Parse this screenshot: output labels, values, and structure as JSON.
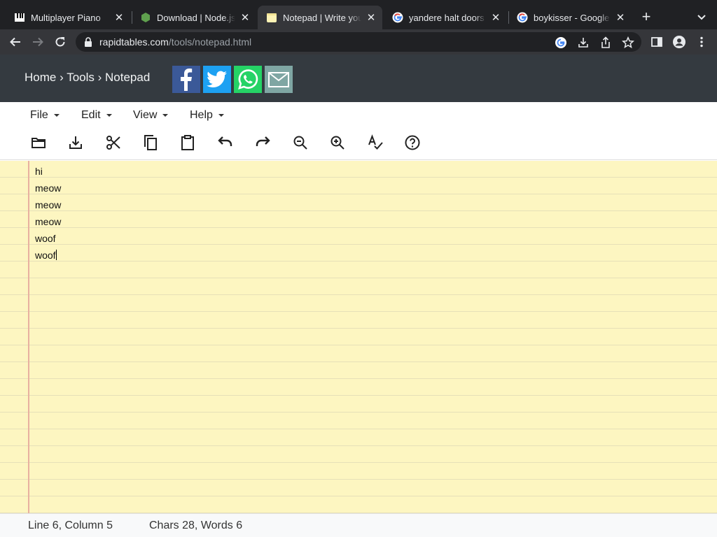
{
  "browser": {
    "tabs": [
      {
        "title": "Multiplayer Piano",
        "favicon": "piano-icon",
        "active": false
      },
      {
        "title": "Download | Node.js",
        "favicon": "nodejs-hexagon-icon",
        "active": false
      },
      {
        "title": "Notepad | Write your text online",
        "favicon": "notepad-icon",
        "active": true
      },
      {
        "title": "yandere halt doors - Google Search",
        "favicon": "google-g-icon",
        "active": false
      },
      {
        "title": "boykisser - Google Search",
        "favicon": "google-g-icon",
        "active": false
      }
    ],
    "new_tab_icon": "plus-icon",
    "url_host": "rapidtables.com",
    "url_path": "/tools/notepad.html"
  },
  "site": {
    "breadcrumb": [
      {
        "label": "Home"
      },
      {
        "label": "Tools"
      },
      {
        "label": "Notepad"
      }
    ],
    "separator": "›",
    "share_buttons": [
      {
        "name": "facebook-share-icon",
        "color": "#3b5998"
      },
      {
        "name": "twitter-share-icon",
        "color": "#1da1f2"
      },
      {
        "name": "whatsapp-share-icon",
        "color": "#25d366"
      },
      {
        "name": "email-share-icon",
        "color": "#7fa6a3"
      }
    ]
  },
  "menu": {
    "items": [
      {
        "label": "File"
      },
      {
        "label": "Edit"
      },
      {
        "label": "View"
      },
      {
        "label": "Help"
      }
    ]
  },
  "tools": [
    "open-folder-icon",
    "download-icon",
    "cut-icon",
    "copy-icon",
    "paste-icon",
    "undo-icon",
    "redo-icon",
    "zoom-out-icon",
    "zoom-in-icon",
    "spellcheck-icon",
    "help-icon"
  ],
  "editor": {
    "lines": [
      "hi",
      "meow",
      "meow",
      "meow",
      "woof",
      "woof"
    ],
    "cursor_line": 6
  },
  "status": {
    "position": "Line 6, Column 5",
    "counts": "Chars 28, Words 6"
  },
  "colors": {
    "paper": "#fdf6c1",
    "margin": "#e8b0a0",
    "header": "#343a40"
  }
}
